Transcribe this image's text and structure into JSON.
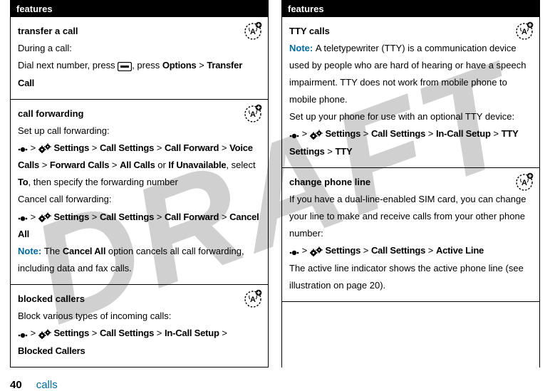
{
  "watermark": "DRAFT",
  "left": {
    "header": "features",
    "cells": [
      {
        "title": "transfer a call",
        "lines": [
          "During a call:",
          {
            "parts": [
              "Dial next number, press ",
              {
                "icon": "key"
              },
              ", press ",
              {
                "b": "Options"
              },
              " > ",
              {
                "b": "Transfer Call"
              }
            ]
          }
        ],
        "badge": true
      },
      {
        "title": "call forwarding",
        "lines": [
          "Set up call forwarding:",
          {
            "parts": [
              {
                "icon": "dot"
              },
              " > ",
              {
                "icon": "gear"
              },
              " ",
              {
                "b": "Settings"
              },
              " > ",
              {
                "b": "Call Settings"
              },
              " > ",
              {
                "b": "Call Forward"
              },
              " > ",
              {
                "b": "Voice Calls"
              },
              " > ",
              {
                "b": "Forward Calls"
              },
              " > ",
              {
                "b": "All Calls"
              },
              " or ",
              {
                "b": "If Unavailable"
              },
              ", select ",
              {
                "b": "To"
              },
              ", then specify the forwarding number"
            ]
          },
          "Cancel call forwarding:",
          {
            "parts": [
              {
                "icon": "dot"
              },
              " > ",
              {
                "icon": "gear"
              },
              " ",
              {
                "b": "Settings"
              },
              " > ",
              {
                "b": "Call Settings"
              },
              " > ",
              {
                "b": "Call Forward"
              },
              " > ",
              {
                "b": "Cancel All"
              }
            ]
          },
          {
            "parts": [
              {
                "note": "Note: "
              },
              "The ",
              {
                "b": "Cancel All"
              },
              " option cancels all call forwarding, including data and fax calls."
            ]
          }
        ],
        "badge": true
      },
      {
        "title": "blocked callers",
        "lines": [
          "Block various types of incoming calls:",
          {
            "parts": [
              {
                "icon": "dot"
              },
              " > ",
              {
                "icon": "gear"
              },
              " ",
              {
                "b": "Settings"
              },
              " > ",
              {
                "b": "Call Settings"
              },
              " > ",
              {
                "b": "In-Call Setup"
              },
              " > ",
              {
                "b": "Blocked Callers"
              }
            ]
          }
        ],
        "badge": true
      }
    ]
  },
  "right": {
    "header": "features",
    "cells": [
      {
        "title": "TTY calls",
        "lines": [
          {
            "parts": [
              {
                "note": "Note: "
              },
              "A teletypewriter (TTY) is a communication device used by people who are hard of hearing or have a speech impairment. TTY does not work from mobile phone to mobile phone."
            ]
          },
          "Set up your phone for use with an optional TTY device:",
          {
            "parts": [
              {
                "icon": "dot"
              },
              " > ",
              {
                "icon": "gear"
              },
              " ",
              {
                "b": "Settings"
              },
              " > ",
              {
                "b": "Call Settings"
              },
              " > ",
              {
                "b": "In-Call Setup"
              },
              " > ",
              {
                "b": "TTY Settings"
              },
              " > ",
              {
                "b": "TTY"
              }
            ]
          }
        ],
        "badge": true
      },
      {
        "title": "change phone line",
        "lines": [
          "If you have a dual-line-enabled SIM card, you can change your line to make and receive calls from your other phone number:",
          {
            "parts": [
              {
                "icon": "dot"
              },
              " > ",
              {
                "icon": "gear"
              },
              " ",
              {
                "b": "Settings"
              },
              " > ",
              {
                "b": "Call Settings"
              },
              " > ",
              {
                "b": "Active Line"
              }
            ]
          },
          "The active line indicator shows the active phone line (see illustration on page 20)."
        ],
        "badge": true
      }
    ]
  },
  "footer": {
    "page": "40",
    "section": "calls"
  }
}
